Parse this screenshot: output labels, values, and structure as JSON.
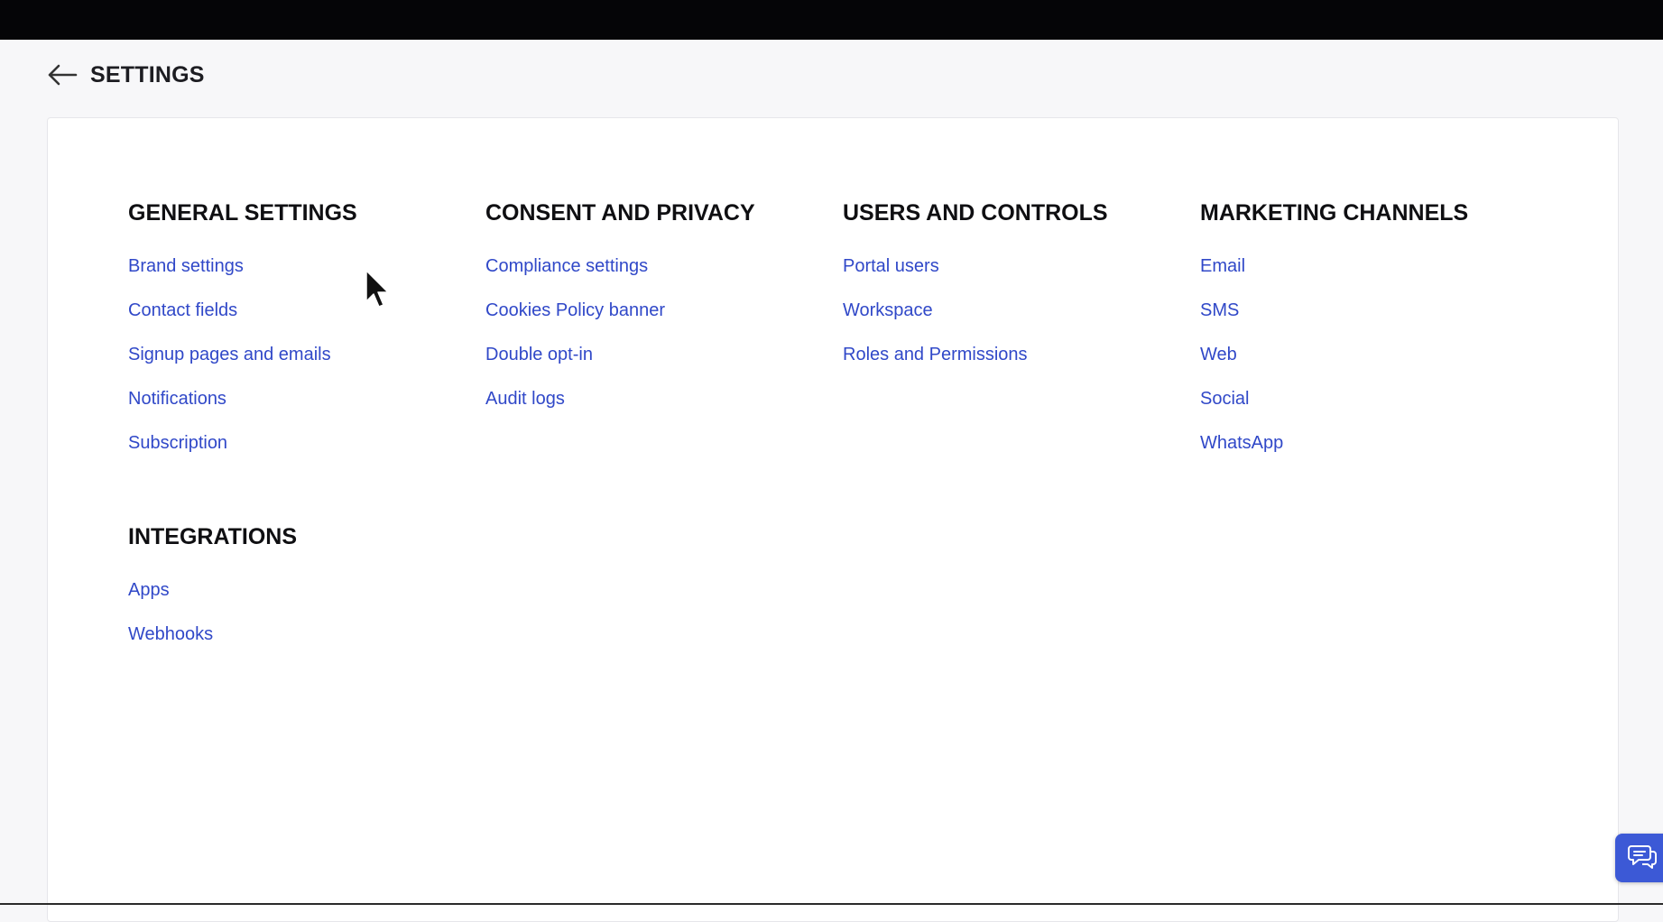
{
  "header": {
    "back_icon": "arrow-left-icon",
    "title": "SETTINGS"
  },
  "sections": {
    "general": {
      "title": "GENERAL SETTINGS",
      "links": [
        "Brand settings",
        "Contact fields",
        "Signup pages and emails",
        "Notifications",
        "Subscription"
      ]
    },
    "consent": {
      "title": "CONSENT AND PRIVACY",
      "links": [
        "Compliance settings",
        "Cookies Policy banner",
        "Double opt-in",
        "Audit logs"
      ]
    },
    "users": {
      "title": "USERS AND CONTROLS",
      "links": [
        "Portal users",
        "Workspace",
        "Roles and Permissions"
      ]
    },
    "marketing": {
      "title": "MARKETING CHANNELS",
      "links": [
        "Email",
        "SMS",
        "Web",
        "Social",
        "WhatsApp"
      ]
    },
    "integrations": {
      "title": "INTEGRATIONS",
      "links": [
        "Apps",
        "Webhooks"
      ]
    }
  },
  "chat_icon": "chat-bubbles-icon",
  "colors": {
    "link": "#3048c8",
    "topbar": "#050507",
    "chat_button": "#3c59d6"
  }
}
